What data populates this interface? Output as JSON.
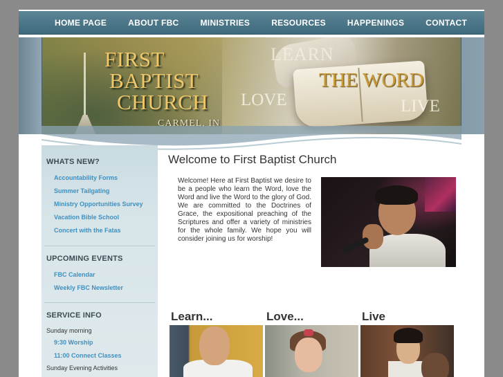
{
  "nav": {
    "items": [
      "HOME PAGE",
      "ABOUT FBC",
      "MINISTRIES",
      "RESOURCES",
      "HAPPENINGS",
      "CONTACT"
    ]
  },
  "banner": {
    "title_lines": [
      "FIRST",
      "BAPTIST",
      "CHURCH"
    ],
    "city": "CARMEL, IN",
    "words": {
      "learn": "LEARN",
      "the_word": "THE WORD",
      "love": "LOVE",
      "live": "LIVE"
    }
  },
  "sidebar": {
    "whats_new": {
      "heading": "WHATS NEW?",
      "links": [
        "Accountability Forms",
        "Summer Tailgating",
        "Ministry Opportunities Survey",
        "Vacation Bible School",
        "Concert with the Fatas"
      ]
    },
    "upcoming_events": {
      "heading": "UPCOMING EVENTS",
      "links": [
        "FBC Calendar",
        "Weekly FBC Newsletter"
      ]
    },
    "service_info": {
      "heading": "SERVICE INFO",
      "sunday_morning": "Sunday morning",
      "links": [
        "9:30 Worship",
        "11:00 Connect Classes"
      ],
      "sunday_evening": "Sunday Evening Activities"
    }
  },
  "main": {
    "title": "Welcome to First Baptist Church",
    "welcome_text": "Welcome! Here at First Baptist we desire to be a people who learn the Word, love the Word and live the Word to the glory of God. We are committed to the Doctrines of Grace, the expositional preaching of the Scriptures and offer a variety of ministries for the whole family. We hope you will consider joining us for worship!",
    "columns": [
      "Learn...",
      "Love...",
      "Live"
    ]
  },
  "colors": {
    "nav_bg": "#4a7587",
    "sidebar_bg": "#d7e5e9",
    "link": "#3f8fbf",
    "heading": "#3c4a52",
    "banner_gold": "#f0c76b"
  }
}
